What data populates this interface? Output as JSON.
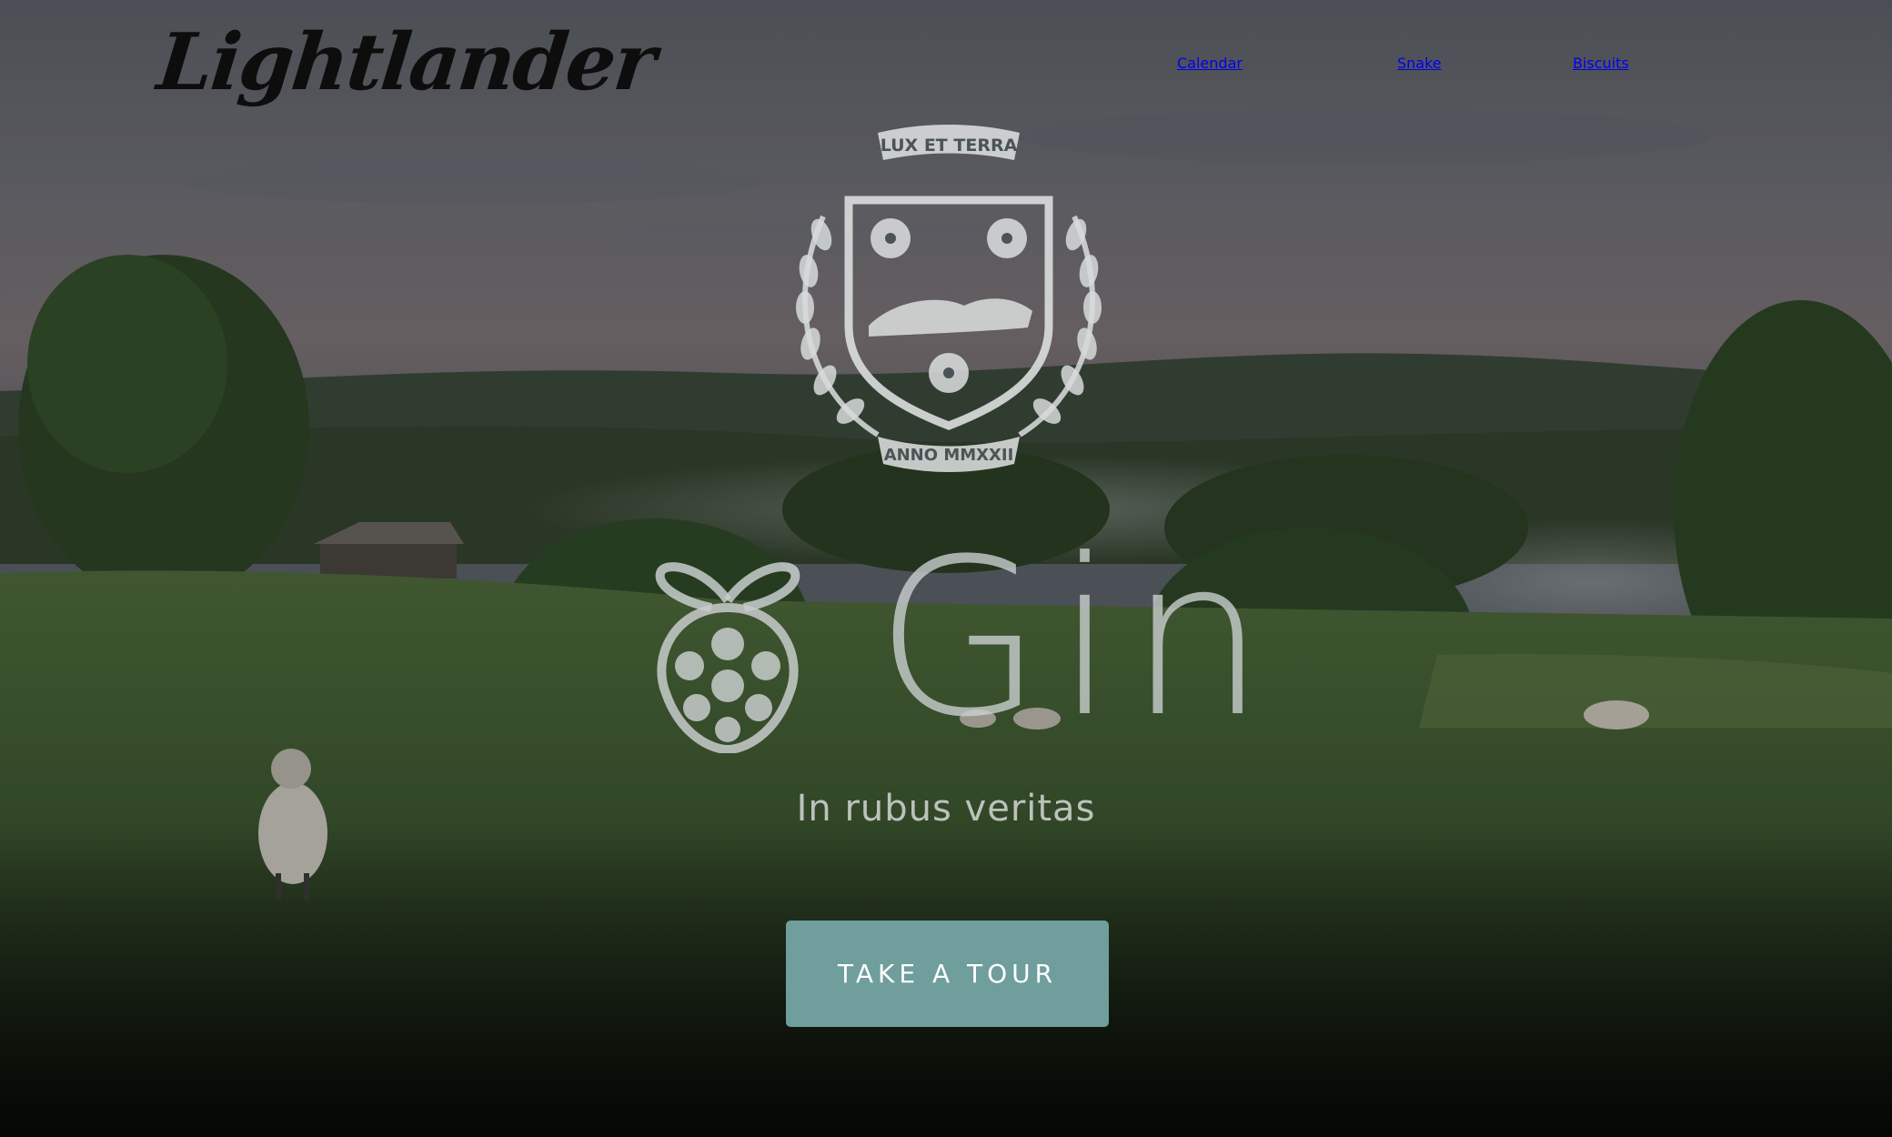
{
  "header": {
    "logo_text": "Lightlander",
    "nav": [
      {
        "label": "Calendar"
      },
      {
        "label": "Snake"
      },
      {
        "label": "Biscuits"
      }
    ]
  },
  "crest": {
    "motto": "LUX ET TERRA",
    "year": "ANNO MMXXII",
    "icon": "heraldic-crest"
  },
  "hero": {
    "brand_icon": "raspberry-icon",
    "brand_name": "Gin",
    "tagline": "In rubus veritas",
    "cta_label": "TAKE A TOUR"
  },
  "colors": {
    "cta": "#6f9e9c",
    "nav_text": "#e6e8ea"
  }
}
